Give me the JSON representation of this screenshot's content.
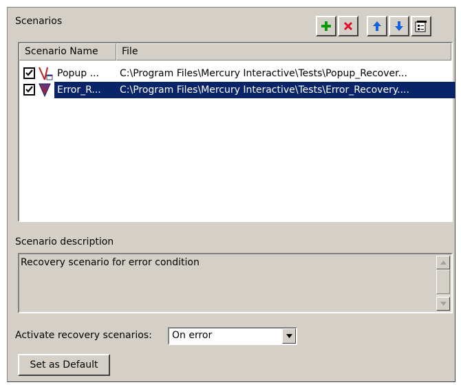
{
  "scenarios": {
    "title": "Scenarios",
    "toolbar": [
      "add-icon",
      "delete-icon",
      "move-up-icon",
      "move-down-icon",
      "properties-icon"
    ],
    "columns": [
      "Scenario Name",
      "File"
    ],
    "rows": [
      {
        "checked": true,
        "icon": "popup-scenario-icon",
        "name": "Popup ...",
        "file": "C:\\Program Files\\Mercury Interactive\\Tests\\Popup_Recover...",
        "selected": false
      },
      {
        "checked": true,
        "icon": "error-scenario-icon",
        "name": "Error_R...",
        "file": "C:\\Program Files\\Mercury Interactive\\Tests\\Error_Recovery....",
        "selected": true
      }
    ]
  },
  "description": {
    "label": "Scenario description",
    "text": "Recovery scenario for error condition"
  },
  "activate": {
    "label": "Activate recovery scenarios:",
    "value": "On error"
  },
  "buttons": {
    "set_default": "Set as Default"
  },
  "colors": {
    "selection": "#0a246a",
    "face": "#d4d0c8",
    "add": "#0a9a0a",
    "delete": "#e0102a",
    "arrow": "#1060e0"
  }
}
